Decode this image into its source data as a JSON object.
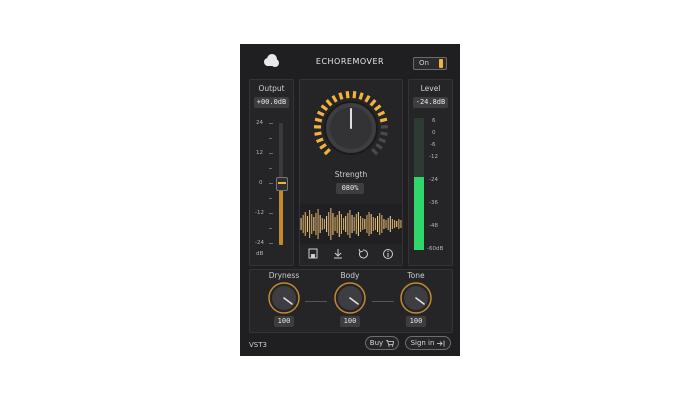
{
  "header": {
    "title": "ECHOREMOVER",
    "power_label": "On"
  },
  "output": {
    "label": "Output",
    "value": "+00.0dB",
    "ticks": [
      "24",
      "12",
      "0",
      "-12",
      "-24"
    ],
    "unit": "dB"
  },
  "strength": {
    "label": "Strength",
    "value": "080%",
    "level": 0.8
  },
  "level_meter": {
    "label": "Level",
    "value": "-24.8dB",
    "ticks": [
      "6",
      "0",
      "-6",
      "-12",
      "-24",
      "-36",
      "-48",
      "-60dB"
    ],
    "fill": 0.55
  },
  "toolbar": {
    "icons": [
      "save-icon",
      "download-icon",
      "reset-icon",
      "info-icon"
    ]
  },
  "knobs": [
    {
      "label": "Dryness",
      "value": "100"
    },
    {
      "label": "Body",
      "value": "100"
    },
    {
      "label": "Tone",
      "value": "100"
    }
  ],
  "footer": {
    "format": "VST3",
    "buy_label": "Buy",
    "signin_label": "Sign in"
  },
  "colors": {
    "accent": "#f2b33d",
    "meter": "#2fd66b",
    "background": "#1f1f22"
  }
}
